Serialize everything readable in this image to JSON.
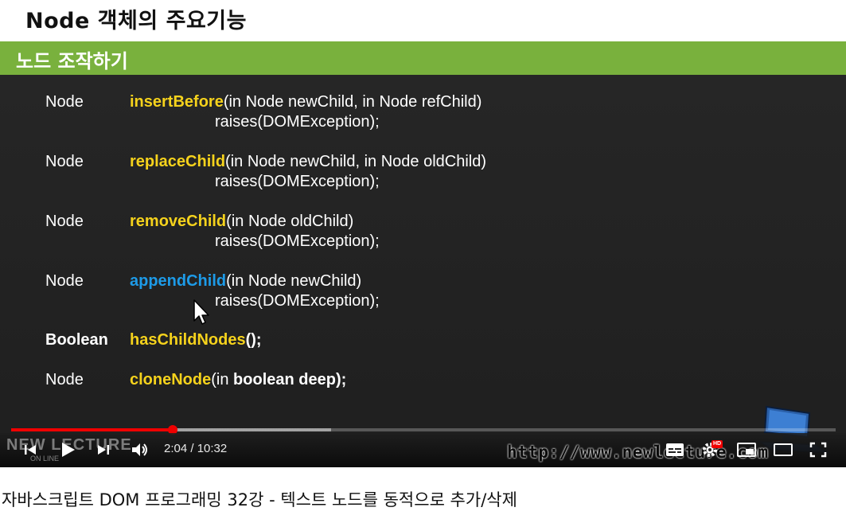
{
  "slide": {
    "title": "Node 객체의 주요기능",
    "section": "노드 조작하기",
    "rows": [
      {
        "return_type": "Node",
        "method": "insertBefore",
        "params": "(in Node newChild, in Node refChild)",
        "raises": "raises(DOMException);"
      },
      {
        "return_type": "Node",
        "method": "replaceChild",
        "params": "(in Node newChild, in Node oldChild)",
        "raises": "raises(DOMException);"
      },
      {
        "return_type": "Node",
        "method": "removeChild",
        "params": "(in Node oldChild)",
        "raises": "raises(DOMException);"
      },
      {
        "return_type": "Node",
        "method": "appendChild",
        "params": "(in Node newChild)",
        "raises": "raises(DOMException);"
      },
      {
        "return_type": "Boolean",
        "method": "hasChildNodes",
        "params": "();"
      },
      {
        "return_type": "Node",
        "method": "cloneNode",
        "params_open": "(in ",
        "params_bold": "boolean deep);"
      }
    ],
    "colors": {
      "method_yellow": "#f5d21c",
      "method_highlight_blue": "#1d9be8",
      "band_green": "#79b13d"
    }
  },
  "player": {
    "current_time": "2:04",
    "duration": "10:32",
    "time_display": "2:04 / 10:32",
    "progress_played": 0.196,
    "progress_buffered": 0.388,
    "watermark_logo": "NEW LECTURE",
    "watermark_logo_sub": "ON LINE",
    "watermark_url": "http://www.newlecture.com",
    "hd_badge": "HD",
    "icons": {
      "prev": "skip-previous-icon",
      "play": "play-icon",
      "next": "skip-next-icon",
      "volume": "volume-icon",
      "subtitles": "subtitles-icon",
      "settings": "gear-icon",
      "miniplayer": "miniplayer-icon",
      "theater": "theater-mode-icon",
      "fullscreen": "fullscreen-icon"
    }
  },
  "video_title": "자바스크립트 DOM 프로그래밍 32강 - 텍스트 노드를 동적으로 추가/삭제"
}
